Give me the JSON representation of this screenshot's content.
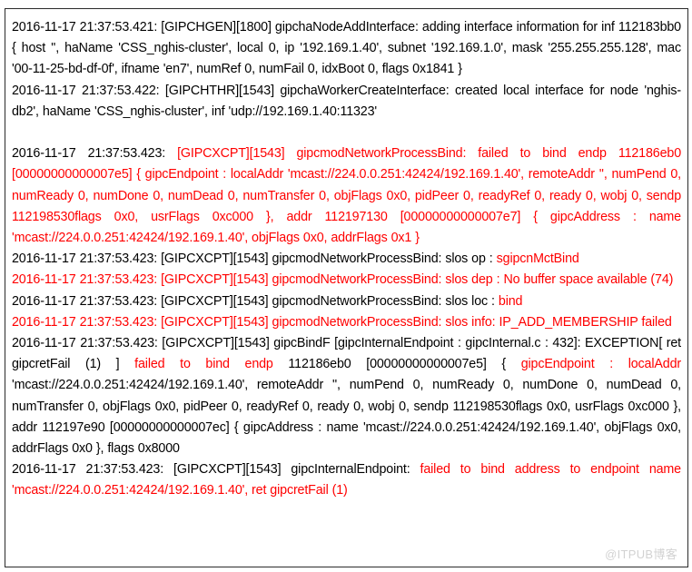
{
  "document": {
    "kind": "log-viewer",
    "watermark": "@ITPUB博客",
    "colors": {
      "error_text": "#ff0000",
      "normal_text": "#000000",
      "border": "#2b2b2b",
      "background": "#ffffff",
      "watermark": "#d2d2d2"
    }
  },
  "log": {
    "entries": [
      {
        "id": "entry-1",
        "segments": [
          {
            "color": "black",
            "text": "2016-11-17  21:37:53.421:  [GIPCHGEN][1800]  gipchaNodeAddInterface: adding  interface  information  for  inf 112183bb0 {  host '',  haName 'CSS_nghis-cluster',  local 0,  ip  '192.169.1.40',  subnet  '192.169.1.0',  mask '255.255.255.128', mac '00-11-25-bd-df-0f', ifname 'en7', numRef 0, numFail 0, idxBoot 0, flags 0x1841 }"
          }
        ]
      },
      {
        "id": "entry-2",
        "segments": [
          {
            "color": "black",
            "text": "2016-11-17  21:37:53.422:  [GIPCHTHR][1543]  gipchaWorkerCreateInterface:  created  local  interface  for  node 'nghis-db2', haName 'CSS_nghis-cluster', inf 'udp://192.169.1.40:11323'"
          }
        ]
      },
      {
        "id": "spacer-1",
        "blank": true
      },
      {
        "id": "entry-3",
        "segments": [
          {
            "color": "black",
            "text": "2016-11-17  21:37:53.423:  "
          },
          {
            "color": "red",
            "text": "[GIPCXCPT][1543]  gipcmodNetworkProcessBind: failed  to  bind  endp  112186eb0 [00000000000007e5]  {  gipcEndpoint  :  localAddr  'mcast://224.0.0.251:42424/192.169.1.40',  remoteAddr  '', numPend 0, numReady 0, numDone 0, numDead 0, numTransfer 0, objFlags 0x0, pidPeer 0, readyRef 0, ready 0, wobj 0, sendp 112198530flags 0x0, usrFlags 0xc000 }, addr 112197130 [00000000000007e7] { gipcAddress : name 'mcast://224.0.0.251:42424/192.169.1.40', objFlags 0x0, addrFlags 0x1 }"
          }
        ]
      },
      {
        "id": "entry-4",
        "segments": [
          {
            "color": "black",
            "text": "2016-11-17 21:37:53.423: [GIPCXCPT][1543] gipcmodNetworkProcessBind: slos op   :   "
          },
          {
            "color": "red",
            "text": "sgipcnMctBind"
          }
        ]
      },
      {
        "id": "entry-5",
        "segments": [
          {
            "color": "red",
            "text": "2016-11-17 21:37:53.423: [GIPCXCPT][1543] gipcmodNetworkProcessBind: slos dep :    No buffer space available (74)"
          }
        ]
      },
      {
        "id": "entry-6",
        "segments": [
          {
            "color": "black",
            "text": "2016-11-17 21:37:53.423: [GIPCXCPT][1543] gipcmodNetworkProcessBind: slos loc :    "
          },
          {
            "color": "red",
            "text": "bind"
          }
        ]
      },
      {
        "id": "entry-7",
        "segments": [
          {
            "color": "red",
            "text": "2016-11-17  21:37:53.423:   [GIPCXCPT][1543]   gipcmodNetworkProcessBind:  slos  info:      IP_ADD_MEMBERSHIP failed"
          }
        ]
      },
      {
        "id": "entry-8",
        "segments": [
          {
            "color": "black",
            "text": "2016-11-17 21:37:53.423: [GIPCXCPT][1543] gipcBindF [gipcInternalEndpoint : gipcInternal.c : 432]: EXCEPTION[ ret gipcretFail  (1)  ]      "
          },
          {
            "color": "red",
            "text": "failed  to  bind  endp  "
          },
          {
            "color": "black",
            "text": "112186eb0  [00000000000007e5]  {  "
          },
          {
            "color": "red",
            "text": "gipcEndpoint  :  localAddr "
          },
          {
            "color": "black",
            "text": "'mcast://224.0.0.251:42424/192.169.1.40', remoteAddr '', numPend 0, numReady 0, numDone 0, numDead 0, numTransfer 0, objFlags 0x0, pidPeer 0, readyRef 0, ready 0, wobj 0, sendp 112198530flags 0x0, usrFlags 0xc000 }, addr 112197e90 [00000000000007ec] { gipcAddress : name 'mcast://224.0.0.251:42424/192.169.1.40', objFlags 0x0, addrFlags 0x0 }, flags 0x8000"
          }
        ]
      },
      {
        "id": "entry-9",
        "segments": [
          {
            "color": "black",
            "text": "2016-11-17  21:37:53.423:  [GIPCXCPT][1543]  gipcInternalEndpoint: "
          },
          {
            "color": "red",
            "text": "failed  to  bind  address  to  endpoint  name 'mcast://224.0.0.251:42424/192.169.1.40', ret gipcretFail (1)"
          }
        ]
      }
    ]
  }
}
